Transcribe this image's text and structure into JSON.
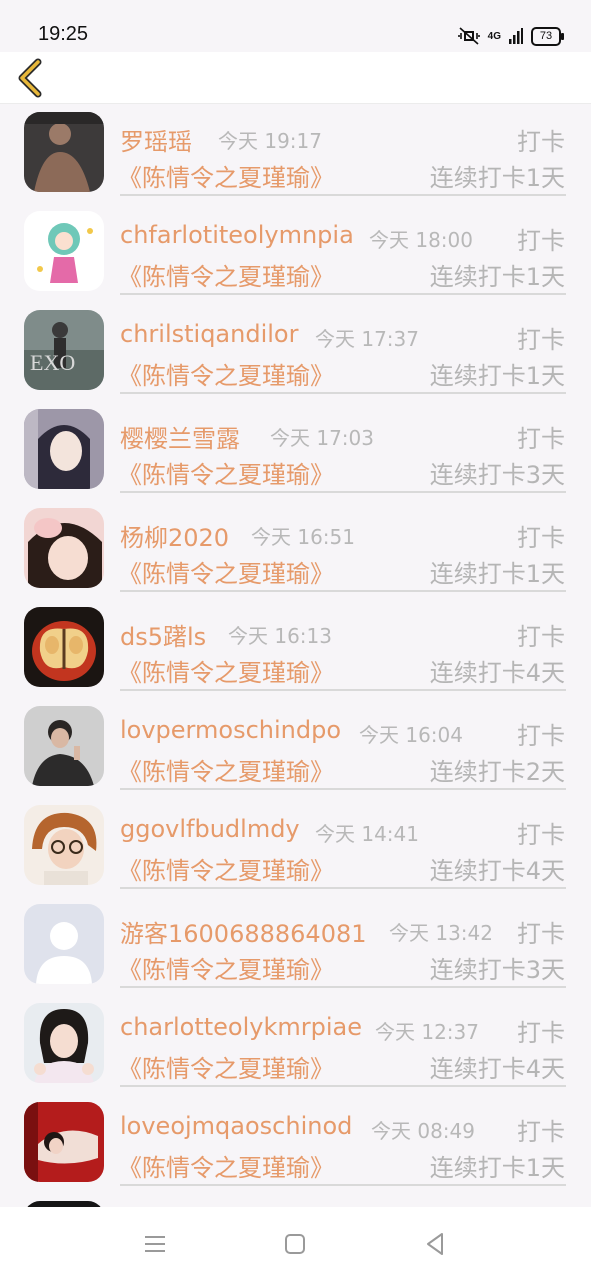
{
  "status_bar": {
    "time": "19:25",
    "network": "4G",
    "battery": "73"
  },
  "list": [
    {
      "name": "罗瑶瑶",
      "time": "今天 19:17",
      "tag": "打卡",
      "book": "《陈情令之夏瑾瑜》",
      "streak": "连续打卡1天"
    },
    {
      "name": "chfarlotiteolymnpia",
      "time": "今天 18:00",
      "tag": "打卡",
      "book": "《陈情令之夏瑾瑜》",
      "streak": "连续打卡1天"
    },
    {
      "name": "chrilstiqandilor",
      "time": "今天 17:37",
      "tag": "打卡",
      "book": "《陈情令之夏瑾瑜》",
      "streak": "连续打卡1天"
    },
    {
      "name": "樱樱兰雪露",
      "time": "今天 17:03",
      "tag": "打卡",
      "book": "《陈情令之夏瑾瑜》",
      "streak": "连续打卡3天"
    },
    {
      "name": "杨柳2020",
      "time": "今天 16:51",
      "tag": "打卡",
      "book": "《陈情令之夏瑾瑜》",
      "streak": "连续打卡1天"
    },
    {
      "name": "ds5躇ls",
      "time": "今天 16:13",
      "tag": "打卡",
      "book": "《陈情令之夏瑾瑜》",
      "streak": "连续打卡4天"
    },
    {
      "name": "lovpermoschindpo",
      "time": "今天 16:04",
      "tag": "打卡",
      "book": "《陈情令之夏瑾瑜》",
      "streak": "连续打卡2天"
    },
    {
      "name": "ggovlfbudlmdy",
      "time": "今天 14:41",
      "tag": "打卡",
      "book": "《陈情令之夏瑾瑜》",
      "streak": "连续打卡4天"
    },
    {
      "name": "游客1600688864081",
      "time": "今天 13:42",
      "tag": "打卡",
      "book": "《陈情令之夏瑾瑜》",
      "streak": "连续打卡3天"
    },
    {
      "name": "charlotteolykmrpiae",
      "time": "今天 12:37",
      "tag": "打卡",
      "book": "《陈情令之夏瑾瑜》",
      "streak": "连续打卡4天"
    },
    {
      "name": "loveojmqaoschinod",
      "time": "今天 08:49",
      "tag": "打卡",
      "book": "《陈情令之夏瑾瑜》",
      "streak": "连续打卡1天"
    }
  ],
  "colors": {
    "accent": "#e69a6a",
    "muted": "#b5b5b5",
    "back_arrow": "#e8b83a"
  }
}
